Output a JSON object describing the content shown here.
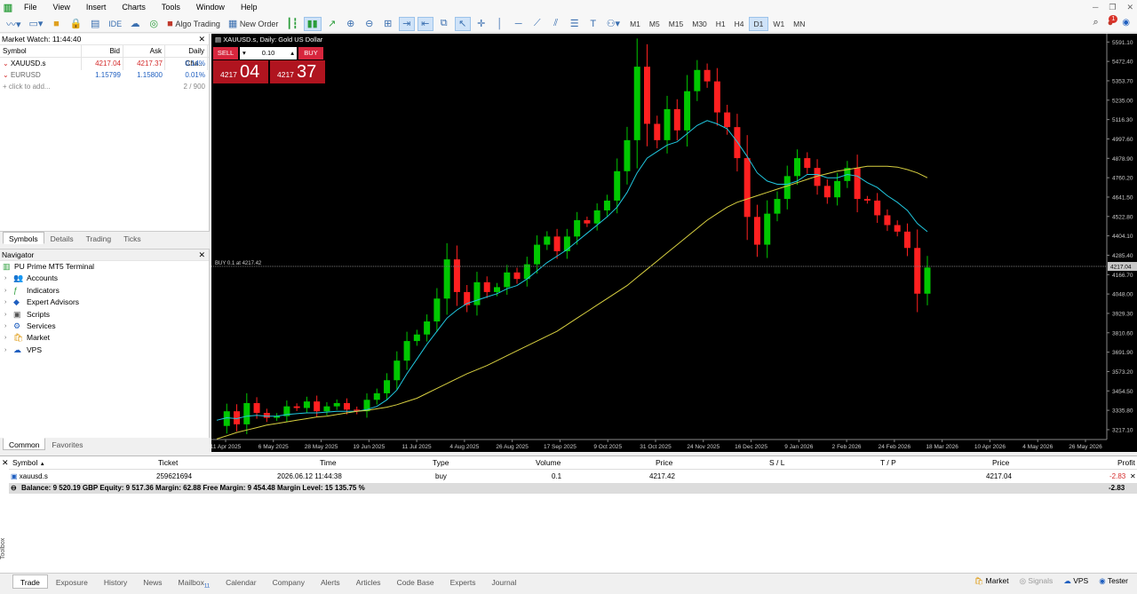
{
  "menu": [
    "File",
    "View",
    "Insert",
    "Charts",
    "Tools",
    "Window",
    "Help"
  ],
  "toolbar": {
    "ide_label": "IDE",
    "algo_label": "Algo Trading",
    "new_order_label": "New Order",
    "timeframes": [
      "M1",
      "M5",
      "M15",
      "M30",
      "H1",
      "H4",
      "D1",
      "W1",
      "MN"
    ],
    "active_timeframe": "D1",
    "notification_count": "1"
  },
  "market_watch": {
    "title": "Market Watch: 11:44:40",
    "columns": [
      "Symbol",
      "Bid",
      "Ask",
      "Daily Cha..."
    ],
    "rows": [
      {
        "symbol": "XAUUSD.s",
        "bid": "4217.04",
        "ask": "4217.37",
        "change": "0.14%"
      },
      {
        "symbol": "EURUSD",
        "bid": "1.15799",
        "ask": "1.15800",
        "change": "0.01%"
      }
    ],
    "add_label": "click to add...",
    "count": "2 / 900",
    "tabs": [
      "Symbols",
      "Details",
      "Trading",
      "Ticks"
    ]
  },
  "navigator": {
    "title": "Navigator",
    "root": "PU Prime MT5 Terminal",
    "items": [
      "Accounts",
      "Indicators",
      "Expert Advisors",
      "Scripts",
      "Services",
      "Market",
      "VPS"
    ],
    "tabs": [
      "Common",
      "Favorites"
    ]
  },
  "chart": {
    "title": "XAUUSD.s, Daily: Gold US Dollar",
    "sell_label": "SELL",
    "buy_label": "BUY",
    "volume": "0.10",
    "sell_small": "4217",
    "sell_big": "04",
    "buy_small": "4217",
    "buy_big": "37",
    "position_label": "BUY 0.1 at 4217.42",
    "current_price_tag": "4217.04"
  },
  "chart_data": {
    "type": "line",
    "x_ticks": [
      "11 Apr 2025",
      "6 May 2025",
      "28 May 2025",
      "19 Jun 2025",
      "11 Jul 2025",
      "4 Aug 2025",
      "26 Aug 2025",
      "17 Sep 2025",
      "9 Oct 2025",
      "31 Oct 2025",
      "24 Nov 2025",
      "16 Dec 2025",
      "9 Jan 2026",
      "2 Feb 2026",
      "24 Feb 2026",
      "18 Mar 2026",
      "10 Apr 2026",
      "4 May 2026",
      "26 May 2026"
    ],
    "y_ticks": [
      "5591.10",
      "5472.40",
      "5353.70",
      "5235.00",
      "5116.30",
      "4997.60",
      "4878.90",
      "4760.20",
      "4641.50",
      "4522.80",
      "4404.10",
      "4285.40",
      "4166.70",
      "4048.00",
      "3929.30",
      "3810.60",
      "3691.90",
      "3573.20",
      "3454.50",
      "3335.80",
      "3217.10"
    ],
    "ylim": [
      3157,
      5620
    ],
    "series": [
      {
        "values": [
          3240,
          3330,
          3250,
          3380,
          3320,
          3290,
          3300,
          3360,
          3350,
          3390,
          3330,
          3360,
          3380,
          3340,
          3330,
          3400,
          3440,
          3520,
          3640,
          3760,
          3800,
          3880,
          4020,
          4260,
          4060,
          3980,
          4120,
          4060,
          4090,
          4180,
          4140,
          4230,
          4350,
          4400,
          4310,
          4400,
          4500,
          4480,
          4560,
          4620,
          4800,
          4990,
          5440,
          5090,
          4990,
          5180,
          5050,
          5290,
          5420,
          5350,
          5160,
          5070,
          4880,
          4520,
          4350,
          4540,
          4630,
          4770,
          4880,
          4820,
          4710,
          4640,
          4740,
          4820,
          4630,
          4620,
          4530,
          4470,
          4430,
          4330,
          4050,
          4210
        ]
      },
      {
        "values": [
          3275,
          3290,
          3285,
          3300,
          3305,
          3300,
          3300,
          3310,
          3315,
          3320,
          3320,
          3325,
          3330,
          3330,
          3330,
          3340,
          3360,
          3400,
          3460,
          3560,
          3650,
          3740,
          3820,
          3900,
          3950,
          3990,
          4010,
          4030,
          4050,
          4080,
          4100,
          4140,
          4190,
          4240,
          4280,
          4320,
          4370,
          4420,
          4470,
          4520,
          4580,
          4670,
          4790,
          4880,
          4920,
          4960,
          4980,
          5030,
          5080,
          5110,
          5090,
          5060,
          4980,
          4890,
          4790,
          4740,
          4720,
          4720,
          4740,
          4780,
          4780,
          4760,
          4760,
          4780,
          4770,
          4730,
          4700,
          4650,
          4610,
          4560,
          4480,
          4430
        ]
      },
      {
        "values": [
          3160,
          3180,
          3200,
          3215,
          3230,
          3245,
          3255,
          3265,
          3275,
          3285,
          3295,
          3300,
          3310,
          3320,
          3330,
          3335,
          3345,
          3355,
          3370,
          3390,
          3410,
          3440,
          3470,
          3500,
          3530,
          3560,
          3585,
          3610,
          3640,
          3670,
          3700,
          3730,
          3760,
          3790,
          3820,
          3860,
          3900,
          3940,
          3980,
          4020,
          4060,
          4100,
          4150,
          4200,
          4250,
          4300,
          4350,
          4400,
          4450,
          4500,
          4540,
          4580,
          4610,
          4630,
          4650,
          4670,
          4690,
          4710,
          4730,
          4750,
          4770,
          4785,
          4800,
          4810,
          4820,
          4830,
          4830,
          4830,
          4825,
          4810,
          4790,
          4760
        ]
      }
    ]
  },
  "toolbox": {
    "columns": [
      "Symbol",
      "Ticket",
      "Time",
      "Type",
      "Volume",
      "Price",
      "S / L",
      "T / P",
      "Price",
      "Profit"
    ],
    "row": {
      "symbol": "xauusd.s",
      "ticket": "259621694",
      "time": "2026.06.12 11:44:38",
      "type": "buy",
      "volume": "0.1",
      "price": "4217.42",
      "sl": "",
      "tp": "",
      "current": "4217.04",
      "profit": "-2.83"
    },
    "balance": "Balance: 9 520.19 GBP  Equity: 9 517.36  Margin: 62.88  Free Margin: 9 454.48  Margin Level: 15 135.75 %",
    "total_profit": "-2.83",
    "side_label": "Toolbox",
    "tabs": [
      "Trade",
      "Exposure",
      "History",
      "News",
      "Mailbox",
      "Calendar",
      "Company",
      "Alerts",
      "Articles",
      "Code Base",
      "Experts",
      "Journal"
    ],
    "mailbox_count": "11"
  },
  "status": {
    "market": "Market",
    "signals": "Signals",
    "vps": "VPS",
    "tester": "Tester"
  },
  "colors": {
    "bull": "#00c800",
    "bear": "#ff2020",
    "ma_fast": "#20c8e0",
    "ma_slow": "#d8d040",
    "sell": "#d7263d"
  }
}
